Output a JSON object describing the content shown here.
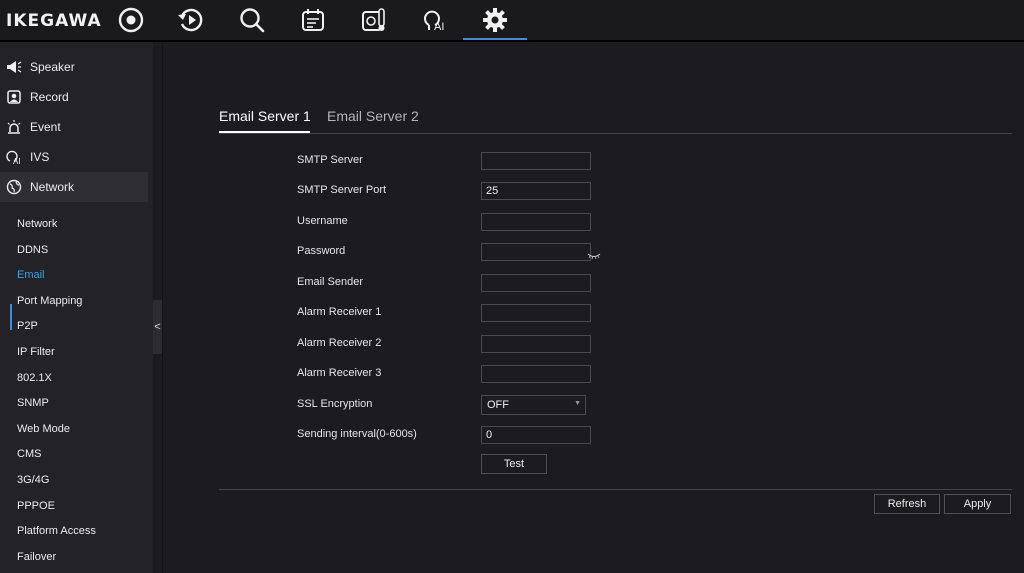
{
  "brand": {
    "name": "IKEGAWA"
  },
  "topnav": [
    {
      "icon": "live-view-icon"
    },
    {
      "icon": "playback-icon"
    },
    {
      "icon": "search-icon"
    },
    {
      "icon": "calendar-icon"
    },
    {
      "icon": "thermal-icon"
    },
    {
      "icon": "ai-icon",
      "label": "AI"
    },
    {
      "icon": "gear-icon",
      "active": true
    }
  ],
  "sidebar": {
    "items": [
      {
        "label": "Speaker",
        "icon": "speaker-icon"
      },
      {
        "label": "Record",
        "icon": "record-icon"
      },
      {
        "label": "Event",
        "icon": "event-icon"
      },
      {
        "label": "IVS",
        "icon": "ivs-icon",
        "icon_text": "AI"
      },
      {
        "label": "Network",
        "icon": "globe-icon",
        "active": true
      }
    ],
    "subitems": [
      {
        "label": "Network"
      },
      {
        "label": "DDNS"
      },
      {
        "label": "Email",
        "active": true
      },
      {
        "label": "Port Mapping"
      },
      {
        "label": "P2P"
      },
      {
        "label": "IP Filter"
      },
      {
        "label": "802.1X"
      },
      {
        "label": "SNMP"
      },
      {
        "label": "Web Mode"
      },
      {
        "label": "CMS"
      },
      {
        "label": "3G/4G"
      },
      {
        "label": "PPPOE"
      },
      {
        "label": "Platform Access"
      },
      {
        "label": "Failover"
      }
    ],
    "collapse_glyph": "<"
  },
  "tabs": [
    {
      "label": "Email Server 1",
      "active": true
    },
    {
      "label": "Email Server 2",
      "active": false
    }
  ],
  "form": {
    "smtp_server": {
      "label": "SMTP Server",
      "value": ""
    },
    "smtp_port": {
      "label": "SMTP Server Port",
      "value": "25"
    },
    "username": {
      "label": "Username",
      "value": ""
    },
    "password": {
      "label": "Password",
      "value": ""
    },
    "email_sender": {
      "label": "Email Sender",
      "value": ""
    },
    "alarm_receiver_1": {
      "label": "Alarm Receiver 1",
      "value": ""
    },
    "alarm_receiver_2": {
      "label": "Alarm Receiver 2",
      "value": ""
    },
    "alarm_receiver_3": {
      "label": "Alarm Receiver 3",
      "value": ""
    },
    "ssl_encryption": {
      "label": "SSL Encryption",
      "value": "OFF"
    },
    "sending_interval": {
      "label": "Sending interval(0-600s)",
      "value": "0"
    },
    "test_label": "Test"
  },
  "footer": {
    "refresh_label": "Refresh",
    "apply_label": "Apply"
  },
  "colors": {
    "accent": "#3a8ee6",
    "background": "#1c1c20",
    "sidebar": "#232327"
  }
}
